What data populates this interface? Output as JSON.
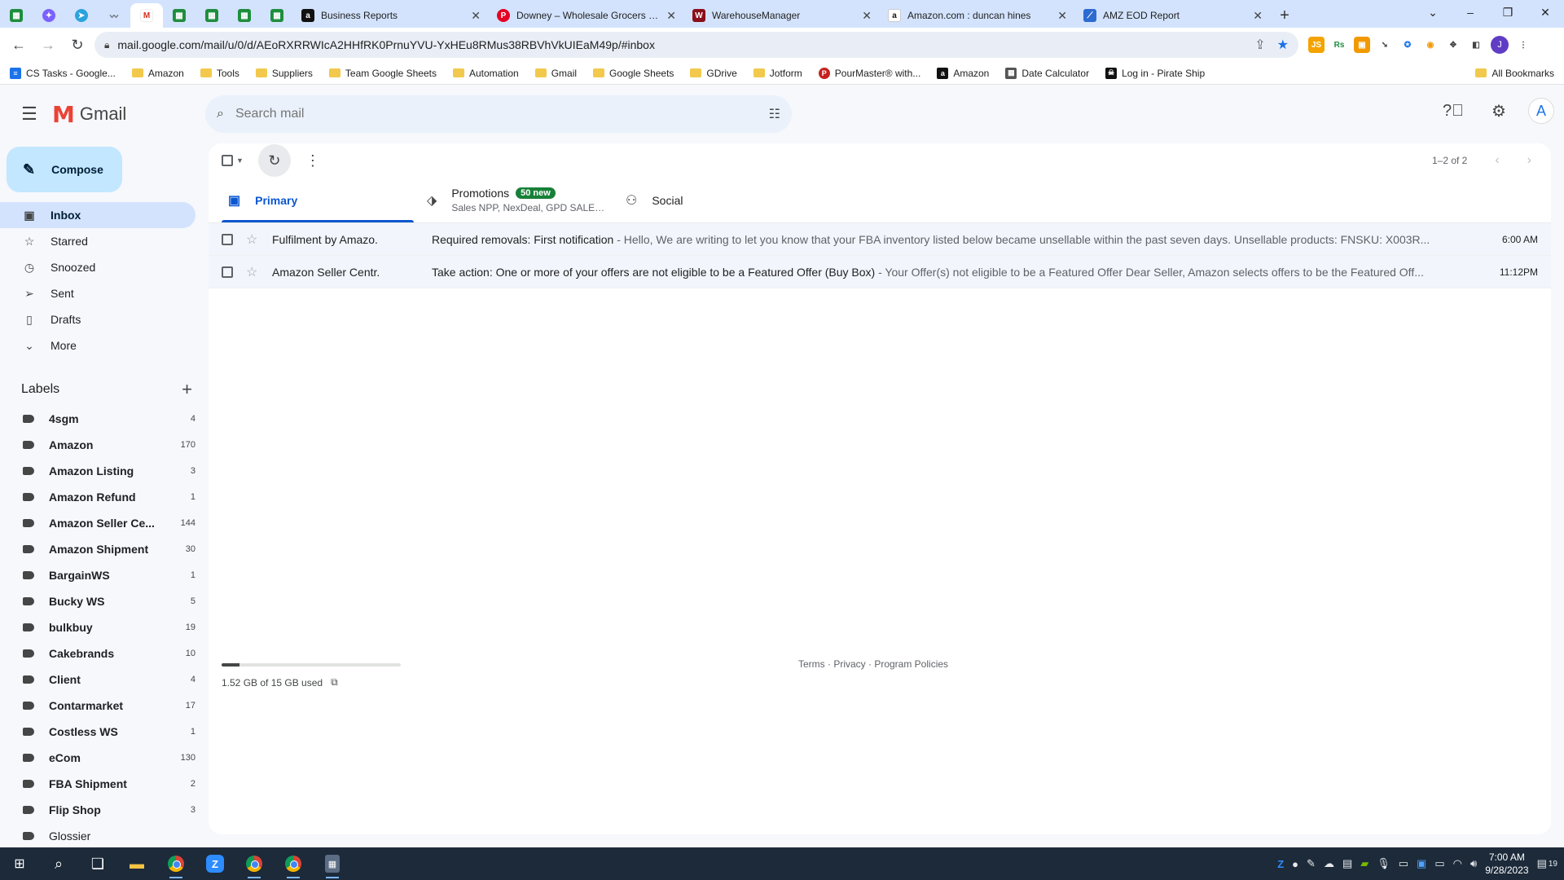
{
  "browser": {
    "tabs": [
      {
        "title": "Business Reports",
        "icon": "amazon-favicon"
      },
      {
        "title": "Downey – Wholesale Grocers & ...",
        "icon": "pinterest-favicon"
      },
      {
        "title": "WarehouseManager",
        "icon": "warehousemanager-favicon"
      },
      {
        "title": "Amazon.com : duncan hines",
        "icon": "amazon-favicon"
      },
      {
        "title": "AMZ EOD Report",
        "icon": "eod-favicon"
      }
    ],
    "pinned_glyphs": {
      "amz": "a",
      "wm": "W",
      "gm": "M",
      "amz2": "a",
      "eod": "⟋",
      "wave": "〰"
    },
    "new_tab": "+",
    "window_controls": {
      "dropdown": "⌄",
      "minimize": "–",
      "restore": "❐",
      "close": "✕"
    },
    "url": "mail.google.com/mail/u/0/d/AEoRXRRWIcA2HHfRK0PrnuYVU-YxHEu8RMus38RBVhVkUIEaM49p/#inbox",
    "profile_initial": "J",
    "extensions": [
      "JS",
      "Rs"
    ]
  },
  "bookmarks": [
    {
      "label": "CS Tasks - Google...",
      "type": "docs"
    },
    {
      "label": "Amazon",
      "type": "folder"
    },
    {
      "label": "Tools",
      "type": "folder"
    },
    {
      "label": "Suppliers",
      "type": "folder"
    },
    {
      "label": "Team Google Sheets",
      "type": "folder"
    },
    {
      "label": "Automation",
      "type": "folder"
    },
    {
      "label": "Gmail",
      "type": "folder"
    },
    {
      "label": "Google Sheets",
      "type": "folder"
    },
    {
      "label": "GDrive",
      "type": "folder"
    },
    {
      "label": "Jotform",
      "type": "folder"
    },
    {
      "label": "PourMaster® with...",
      "type": "site"
    },
    {
      "label": "Amazon",
      "type": "amazon"
    },
    {
      "label": "Date Calculator",
      "type": "calc"
    },
    {
      "label": "Log in - Pirate Ship",
      "type": "pirate"
    }
  ],
  "bookmark_glyphs": {
    "docs": "≡",
    "amazon": "a",
    "calc": "▦",
    "pirate": "☠",
    "site": "P"
  },
  "all_bookmarks": "All Bookmarks",
  "gmail": {
    "logo_glyph": "M",
    "logo_text": "Gmail",
    "search_placeholder": "Search mail",
    "avatar_initial": "A",
    "compose": "Compose",
    "nav": [
      {
        "label": "Inbox",
        "icon": "inbox-icon",
        "glyph": "▣",
        "active": true
      },
      {
        "label": "Starred",
        "icon": "star-icon",
        "glyph": "☆"
      },
      {
        "label": "Snoozed",
        "icon": "clock-icon",
        "glyph": "◷"
      },
      {
        "label": "Sent",
        "icon": "send-icon",
        "glyph": "➢"
      },
      {
        "label": "Drafts",
        "icon": "draft-icon",
        "glyph": "▯"
      },
      {
        "label": "More",
        "icon": "chevron-down-icon",
        "glyph": "⌄"
      }
    ],
    "labels_title": "Labels",
    "labels": [
      {
        "name": "4sgm",
        "count": "4"
      },
      {
        "name": "Amazon",
        "count": "170"
      },
      {
        "name": "Amazon Listing",
        "count": "3"
      },
      {
        "name": "Amazon Refund",
        "count": "1"
      },
      {
        "name": "Amazon Seller Ce...",
        "count": "144"
      },
      {
        "name": "Amazon Shipment",
        "count": "30"
      },
      {
        "name": "BargainWS",
        "count": "1"
      },
      {
        "name": "Bucky WS",
        "count": "5"
      },
      {
        "name": "bulkbuy",
        "count": "19"
      },
      {
        "name": "Cakebrands",
        "count": "10"
      },
      {
        "name": "Client",
        "count": "4"
      },
      {
        "name": "Contarmarket",
        "count": "17"
      },
      {
        "name": "Costless WS",
        "count": "1"
      },
      {
        "name": "eCom",
        "count": "130"
      },
      {
        "name": "FBA Shipment",
        "count": "2"
      },
      {
        "name": "Flip Shop",
        "count": "3"
      },
      {
        "name": "Glossier",
        "count": ""
      }
    ],
    "pagination": "1–2 of 2",
    "tabs": {
      "primary": "Primary",
      "promotions": "Promotions",
      "promotions_badge": "50 new",
      "promotions_sub": "Sales NPP, NexDeal, GPD SALES...",
      "social": "Social"
    },
    "emails": [
      {
        "sender": "Fulfilment by Amazo.",
        "subject": "Required removals: First notification",
        "snippet": " - Hello, We are writing to let you know that your FBA inventory listed below became unsellable within the past seven days. Unsellable products: FNSKU: X003R...",
        "time": "6:00 AM"
      },
      {
        "sender": "Amazon Seller Centr.",
        "subject": "Take action: One or more of your offers are not eligible to be a Featured Offer (Buy Box)",
        "snippet": " - Your Offer(s) not eligible to be a Featured Offer Dear Seller, Amazon selects offers to be the Featured Off...",
        "time": "11:12PM"
      }
    ],
    "storage": {
      "text": "1.52 GB of 15 GB used",
      "fraction": 0.101
    },
    "policies": "Terms · Privacy · Program Policies"
  },
  "taskbar": {
    "clock_time": "7:00 AM",
    "clock_date": "9/28/2023",
    "notification_count": "19",
    "zoom_glyph": "Z",
    "calc_glyph": "▦"
  }
}
